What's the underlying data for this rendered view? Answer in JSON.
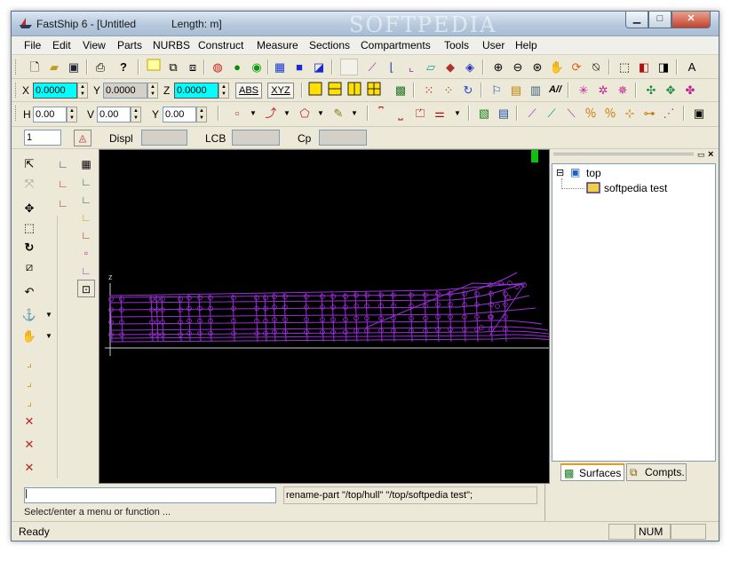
{
  "window": {
    "title": "FastShip 6 - [Untitled",
    "length_label": "Length: m]",
    "watermark": "SOFTPEDIA"
  },
  "caption_buttons": {
    "minimize": "▁",
    "maximize": "□",
    "close": "✕"
  },
  "menu": [
    "File",
    "Edit",
    "View",
    "Parts",
    "NURBS",
    "Construct",
    "Measure",
    "Sections",
    "Compartments",
    "Tools",
    "User",
    "Help"
  ],
  "coords": {
    "x_label": "X",
    "x_value": "0.0000",
    "y_label": "Y",
    "y_value": "0.0000",
    "z_label": "Z",
    "z_value": "0.0000",
    "abs_button": "ABS",
    "xyz_button": "XYZ"
  },
  "hvy": {
    "h_label": "H",
    "h_value": "0.00",
    "v_label": "V",
    "v_value": "0.00",
    "y_label": "Y",
    "y_value": "0.00"
  },
  "hydro": {
    "field_value": "1",
    "displ_label": "Displ",
    "lcb_label": "LCB",
    "cp_label": "Cp"
  },
  "viewport": {
    "axis_label": "z"
  },
  "tree": {
    "root_label": "top",
    "child_label": "softpedia test",
    "expand_symbol": "⊟"
  },
  "tabs": {
    "surfaces": "Surfaces",
    "compts": "Compts."
  },
  "command": {
    "input_value": "|",
    "echo": "rename-part \"/top/hull\" \"/top/softpedia test\";",
    "hint": "Select/enter a menu or function ..."
  },
  "status": {
    "ready": "Ready",
    "num": "NUM"
  },
  "colors": {
    "viewport_bg": "#000000",
    "hull_lines": "#9a2fd8",
    "highlight": "#00ffff"
  }
}
